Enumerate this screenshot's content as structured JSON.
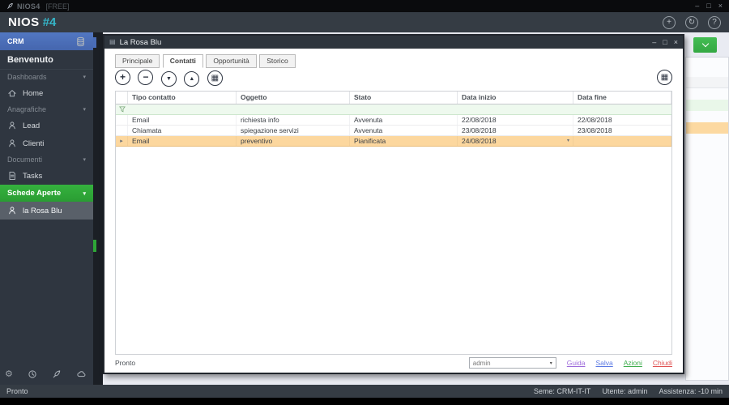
{
  "icons": {
    "minimize": "–",
    "maximize": "□",
    "close": "×",
    "add": "+",
    "sync": "↻",
    "help": "?",
    "plus": "+",
    "minus": "−",
    "arrow_down": "▼",
    "arrow_up": "▲",
    "grid": "▦",
    "calendar": "▦",
    "caret_down": "▾",
    "row_pointer": "▸",
    "window_glyph": "▤"
  },
  "os_titlebar": {
    "app_name": "NIOS4",
    "edition": "[FREE]"
  },
  "app_header": {
    "brand": "NIOS",
    "version": "#4"
  },
  "sidebar": {
    "module_label": "CRM",
    "welcome": "Benvenuto",
    "section_dashboards": "Dashboards",
    "item_home": "Home",
    "section_anagrafiche": "Anagrafiche",
    "item_lead": "Lead",
    "item_clienti": "Clienti",
    "section_documenti": "Documenti",
    "item_tasks": "Tasks",
    "section_schede": "Schede Aperte",
    "item_rosa": "la Rosa Blu"
  },
  "window": {
    "title": "La Rosa Blu",
    "tabs": [
      "Principale",
      "Contatti",
      "Opportunità",
      "Storico"
    ],
    "active_tab": "Contatti",
    "table": {
      "columns": [
        "Tipo contatto",
        "Oggetto",
        "Stato",
        "Data inizio",
        "Data fine"
      ],
      "rows": [
        {
          "tipo": "Email",
          "oggetto": "richiesta info",
          "stato": "Avvenuta",
          "inizio": "22/08/2018",
          "fine": "22/08/2018"
        },
        {
          "tipo": "Chiamata",
          "oggetto": "spiegazione servizi",
          "stato": "Avvenuta",
          "inizio": "23/08/2018",
          "fine": "23/08/2018"
        },
        {
          "tipo": "Email",
          "oggetto": "preventivo",
          "stato": "Pianificata",
          "inizio": "24/08/2018",
          "fine": ""
        }
      ]
    },
    "footer": {
      "status": "Pronto",
      "user": "admin",
      "link_guida": "Guida",
      "link_salva": "Salva",
      "link_azioni": "Azioni",
      "link_chiudi": "Chiudi"
    }
  },
  "statusbar": {
    "status": "Pronto",
    "seme": "Seme: CRM-IT-IT",
    "utente": "Utente: admin",
    "assistenza": "Assistenza: -10 min"
  },
  "colors": {
    "accent_blue": "#4a6db8",
    "accent_green": "#2ea637",
    "brand_teal": "#35b5c8",
    "selected_row": "#fcd79e"
  }
}
